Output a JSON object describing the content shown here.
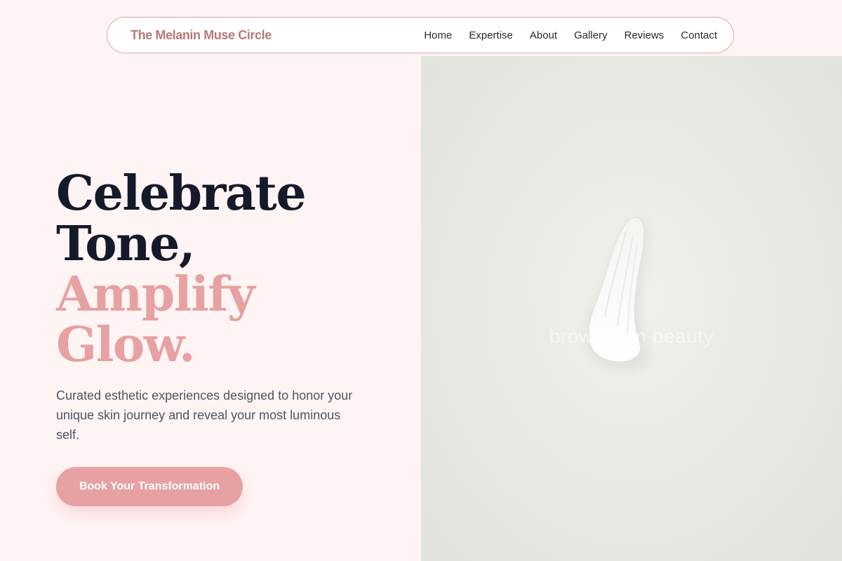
{
  "brand": {
    "name": "The Melanin Muse Circle"
  },
  "nav": {
    "links": [
      "Home",
      "Expertise",
      "About",
      "Gallery",
      "Reviews",
      "Contact"
    ]
  },
  "hero": {
    "headline_dark": [
      "Celebrate",
      "Tone,"
    ],
    "headline_accent": [
      "Amplify",
      "Glow."
    ],
    "subtitle": "Curated esthetic experiences designed to honor your unique skin journey and reveal your most luminous self.",
    "cta_label": "Book Your Transformation",
    "image_watermark": "brown skin beauty"
  },
  "colors": {
    "page_background": "#fff4f4",
    "accent": "#e7a1a2",
    "brand_text": "#b8797a",
    "headline_dark": "#141a2b",
    "body_text": "#4c5363"
  }
}
